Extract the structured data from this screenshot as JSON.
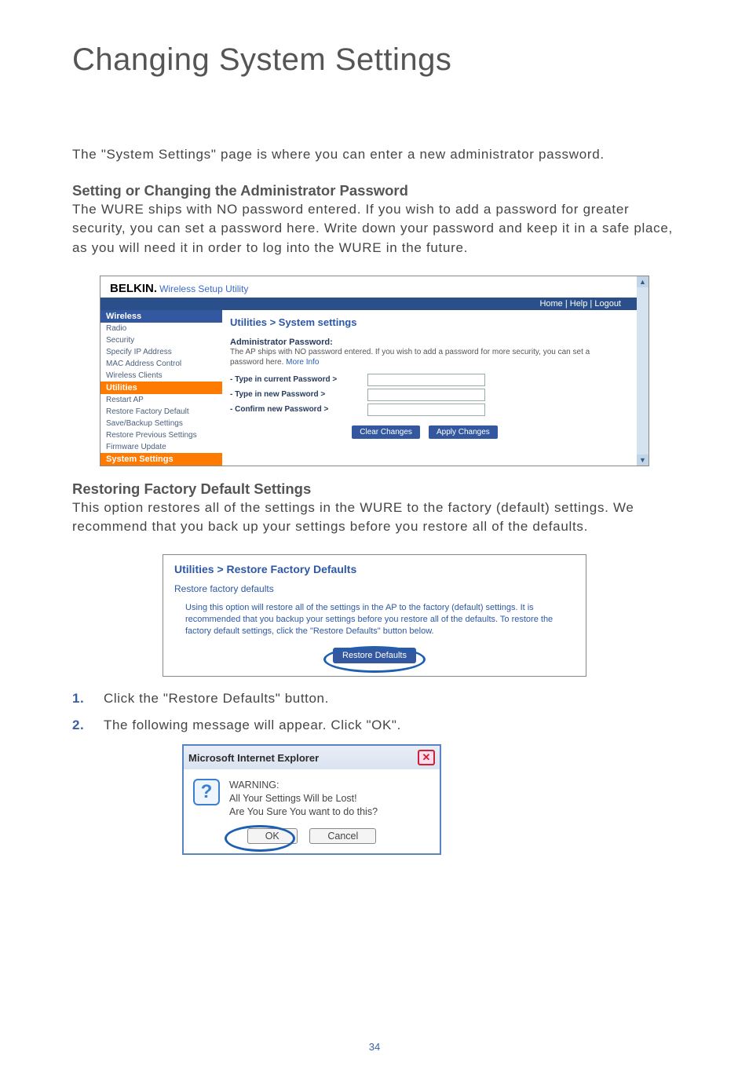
{
  "page_title": "Changing System Settings",
  "intro": "The \"System Settings\" page is where you can enter a new administrator password.",
  "sec1_head": "Setting or Changing the Administrator Password",
  "sec1_body": "The WURE ships with NO password entered. If you wish to add a password for greater security, you can set a password here. Write down your password and keep it in a safe place, as you will need it in order to log into the WURE in the future.",
  "ss1": {
    "brand": "BELKIN.",
    "brand_sub": "Wireless Setup Utility",
    "topbar": "Home | Help | Logout",
    "nav": {
      "cat1": "Wireless",
      "items1": [
        "Radio",
        "Security",
        "Specify IP Address",
        "MAC Address Control",
        "Wireless Clients"
      ],
      "cat2": "Utilities",
      "items2": [
        "Restart AP",
        "Restore Factory Default",
        "Save/Backup Settings",
        "Restore Previous Settings",
        "Firmware Update"
      ],
      "cat3": "System Settings"
    },
    "crumb": "Utilities > System settings",
    "ap_head": "Administrator Password:",
    "ap_desc": "The AP ships with NO password entered. If you wish to add a password for more security, you can set a password here.",
    "ap_more": "More Info",
    "row1": "- Type in current Password >",
    "row2": "- Type in new Password >",
    "row3": "- Confirm new Password >",
    "btn_clear": "Clear Changes",
    "btn_apply": "Apply Changes"
  },
  "sec2_head": "Restoring Factory Default Settings",
  "sec2_body": "This option restores all of the settings in the WURE to the factory (default) settings. We recommend that you back up your settings before you restore all of the defaults.",
  "ss2": {
    "crumb": "Utilities > Restore Factory Defaults",
    "sub": "Restore factory defaults",
    "desc": "Using this option will restore all of the settings in the AP to the factory (default) settings. It is recommended that you backup your settings before you restore all of the defaults. To restore the factory default settings, click the \"Restore Defaults\" button below.",
    "btn": "Restore Defaults"
  },
  "steps": {
    "n1": "1.",
    "t1": "Click the \"Restore Defaults\" button.",
    "n2": "2.",
    "t2": "The following message will appear. Click \"OK\"."
  },
  "dlg": {
    "title": "Microsoft Internet Explorer",
    "l1": "WARNING:",
    "l2": "All Your Settings Will be Lost!",
    "l3": "Are You Sure You want to do this?",
    "ok": "OK",
    "cancel": "Cancel"
  },
  "pagenum": "34"
}
